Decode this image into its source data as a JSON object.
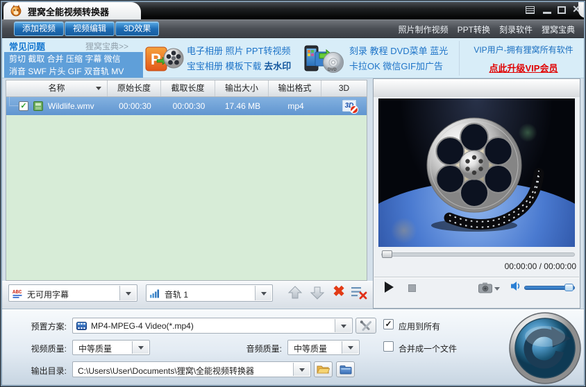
{
  "window": {
    "title": "狸窝全能视频转换器"
  },
  "toolbar": {
    "buttons": [
      "添加视频",
      "视频编辑",
      "3D效果"
    ],
    "links": [
      "照片制作视频",
      "PPT转换",
      "刻录软件",
      "狸窝宝典"
    ]
  },
  "banner": {
    "faq_title": "常见问题",
    "faq_more": "狸窝宝典>>",
    "faq_row1": "剪切 截取 合并 压缩 字幕 微信",
    "faq_row2": "消音 SWF 片头 GIF 双音轨 MV",
    "ppt_row1": "电子相册 照片 PPT转视频",
    "ppt_row2_normal": "宝宝相册 模板下载 ",
    "ppt_row2_bold": "去水印",
    "burn_row1": "刻录 教程 DVD菜单 蓝光",
    "burn_row2": "卡拉OK 微信GIF加广告",
    "vip_line1": "VIP用户-拥有狸窝所有软件",
    "vip_link": "点此升级VIP会员"
  },
  "table": {
    "headers": [
      "名称",
      "原始长度",
      "截取长度",
      "输出大小",
      "输出格式",
      "3D"
    ],
    "row": {
      "name": "Wildlife.wmv",
      "original": "00:00:30",
      "cut": "00:00:30",
      "size": "17.46 MB",
      "format": "mp4"
    }
  },
  "listbar": {
    "subtitle_value": "无可用字幕",
    "audio_value": "音轨 1"
  },
  "player": {
    "time": "00:00:00 / 00:00:00"
  },
  "settings": {
    "preset_label": "预置方案:",
    "preset_value": "MP4-MPEG-4 Video(*.mp4)",
    "video_quality_label": "视频质量:",
    "video_quality_value": "中等质量",
    "audio_quality_label": "音频质量:",
    "audio_quality_value": "中等质量",
    "output_label": "输出目录:",
    "output_value": "C:\\Users\\User\\Documents\\狸窝\\全能视频转换器",
    "apply_all_label": "应用到所有",
    "merge_label": "合并成一个文件"
  },
  "glyphs": {
    "check": "✓",
    "delete_x": "✖",
    "close": "×",
    "3d": "3D"
  },
  "colors": {
    "accent_blue": "#1e74c8",
    "vip_red": "#e10000",
    "selected_row": "#6b9dd6",
    "list_bg": "#d7ecd7",
    "button_blue": "#1f6db3"
  }
}
